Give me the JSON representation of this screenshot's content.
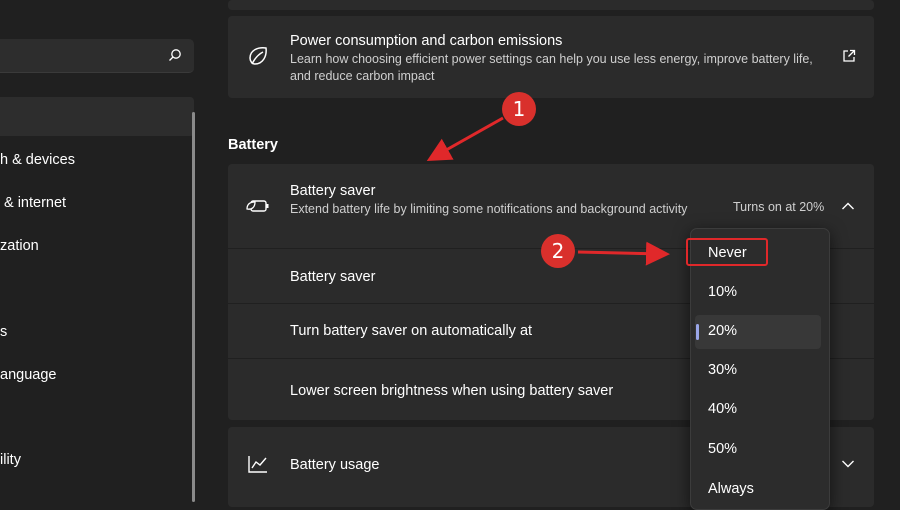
{
  "sidebar": {
    "search_placeholder": "",
    "items": [
      {
        "label": "h & devices"
      },
      {
        "label": "& internet"
      },
      {
        "label": "zation"
      },
      {
        "label": "s"
      },
      {
        "label": "anguage"
      },
      {
        "label": "ility"
      }
    ]
  },
  "power_card": {
    "title": "Power consumption and carbon emissions",
    "description": "Learn how choosing efficient power settings can help you use less energy, improve battery life, and reduce carbon impact",
    "icon": "leaf-icon",
    "action_icon": "open-external-icon"
  },
  "battery_section": {
    "title": "Battery",
    "saver": {
      "title": "Battery saver",
      "description": "Extend battery life by limiting some notifications and background activity",
      "status": "Turns on at 20%",
      "icon": "battery-saver-icon"
    },
    "rows": [
      {
        "label": "Battery saver"
      },
      {
        "label": "Turn battery saver on automatically at"
      },
      {
        "label": "Lower screen brightness when using battery saver"
      }
    ],
    "usage": {
      "title": "Battery usage",
      "icon": "chart-icon"
    }
  },
  "dropdown": {
    "options": [
      "Never",
      "10%",
      "20%",
      "30%",
      "40%",
      "50%",
      "Always"
    ],
    "selected": "20%"
  },
  "annotations": [
    {
      "label": "1"
    },
    {
      "label": "2"
    }
  ],
  "colors": {
    "background": "#202020",
    "card": "#2b2b2b",
    "annotation_red": "#d9302c",
    "selection_accent": "#9aa6e8"
  }
}
